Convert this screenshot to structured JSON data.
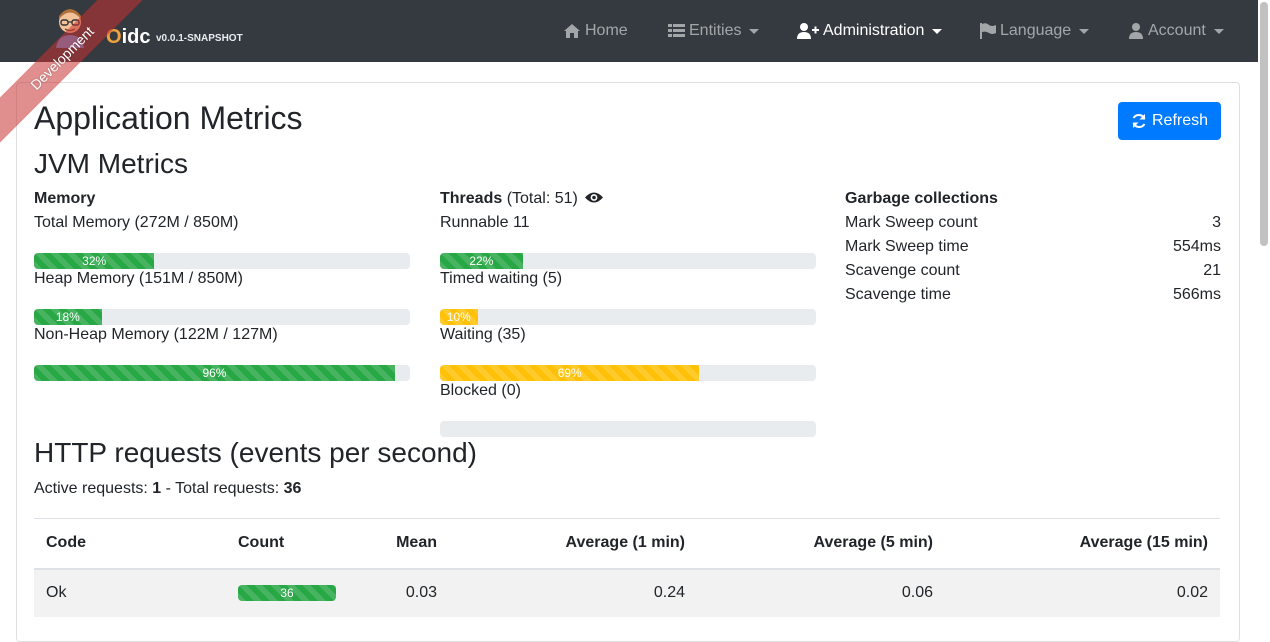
{
  "navbar": {
    "brand_title_o": "O",
    "brand_title_rest": "idc",
    "version": "v0.0.1-SNAPSHOT",
    "ribbon": "Development",
    "items": [
      {
        "label": "Home",
        "icon": "home-icon"
      },
      {
        "label": "Entities",
        "icon": "list-icon"
      },
      {
        "label": "Administration",
        "icon": "user-plus-icon"
      },
      {
        "label": "Language",
        "icon": "flag-icon"
      },
      {
        "label": "Account",
        "icon": "user-icon"
      }
    ]
  },
  "page": {
    "title": "Application Metrics",
    "refresh_label": "Refresh"
  },
  "jvm": {
    "title": "JVM Metrics",
    "memory": {
      "heading": "Memory",
      "items": [
        {
          "label": "Total Memory (272M / 850M)",
          "percent": 32,
          "percent_label": "32%"
        },
        {
          "label": "Heap Memory (151M / 850M)",
          "percent": 18,
          "percent_label": "18%"
        },
        {
          "label": "Non-Heap Memory (122M / 127M)",
          "percent": 96,
          "percent_label": "96%"
        }
      ]
    },
    "threads": {
      "heading": "Threads",
      "total": "(Total: 51)",
      "items": [
        {
          "label": "Runnable 11",
          "percent": 22,
          "percent_label": "22%",
          "color": "#28a745"
        },
        {
          "label": "Timed waiting (5)",
          "percent": 10,
          "percent_label": "10%",
          "color": "#ffc107"
        },
        {
          "label": "Waiting (35)",
          "percent": 69,
          "percent_label": "69%",
          "color": "#ffc107"
        },
        {
          "label": "Blocked (0)",
          "percent": 0,
          "percent_label": "",
          "color": "#dc3545"
        }
      ]
    },
    "gc": {
      "heading": "Garbage collections",
      "rows": [
        {
          "label": "Mark Sweep count",
          "value": "3"
        },
        {
          "label": "Mark Sweep time",
          "value": "554ms"
        },
        {
          "label": "Scavenge count",
          "value": "21"
        },
        {
          "label": "Scavenge time",
          "value": "566ms"
        }
      ]
    }
  },
  "http": {
    "title": "HTTP requests (events per second)",
    "active_label": "Active requests:",
    "active_value": "1",
    "separator": "-",
    "total_label": "Total requests:",
    "total_value": "36",
    "headers": [
      "Code",
      "Count",
      "Mean",
      "Average (1 min)",
      "Average (5 min)",
      "Average (15 min)"
    ],
    "rows": [
      {
        "code": "Ok",
        "count": "36",
        "count_percent": 100,
        "mean": "0.03",
        "avg1": "0.24",
        "avg5": "0.06",
        "avg15": "0.02"
      }
    ]
  },
  "colors": {
    "navbar_bg": "#343a40",
    "primary": "#007bff",
    "success": "#28a745",
    "warning": "#ffc107"
  }
}
